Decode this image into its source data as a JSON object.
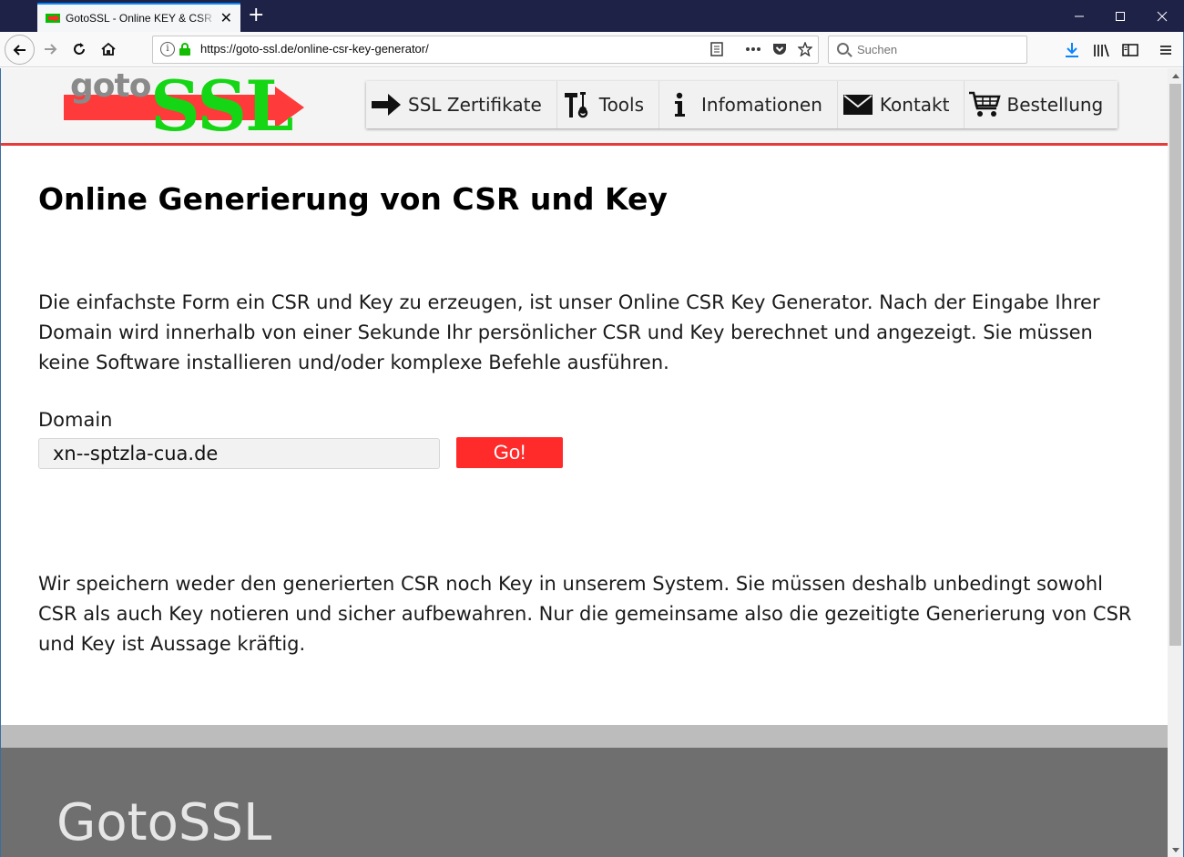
{
  "browser": {
    "tab_title": "GotoSSL - Online KEY & CSR für",
    "tab_close": "✕",
    "new_tab": "+",
    "url": "https://goto-ssl.de/online-csr-key-generator/",
    "search_placeholder": "Suchen",
    "window_controls": {
      "minimize": "—",
      "maximize": "☐",
      "close": "✕"
    }
  },
  "site": {
    "logo": {
      "goto": "goto",
      "ssl": "SSL"
    },
    "menu": [
      {
        "label": "SSL Zertifikate",
        "icon": "arrow-right-icon"
      },
      {
        "label": "Tools",
        "icon": "tools-icon"
      },
      {
        "label": "Infomationen",
        "icon": "info-icon"
      },
      {
        "label": "Kontakt",
        "icon": "mail-icon"
      },
      {
        "label": "Bestellung",
        "icon": "cart-icon"
      }
    ],
    "accent_color": "#e53b3b",
    "logo_green": "#14d614"
  },
  "main": {
    "title": "Online Generierung von CSR und Key",
    "intro": "Die einfachste Form ein CSR und Key zu erzeugen, ist unser Online CSR Key Generator. Nach der Eingabe Ihrer Domain wird innerhalb von einer Sekunde Ihr persönlicher CSR und Key berechnet und angezeigt. Sie müssen keine Software installieren und/oder komplexe Befehle ausführen.",
    "domain_label": "Domain",
    "domain_value": "xn--sptzla-cua.de",
    "go_label": "Go!",
    "notice": "Wir speichern weder den generierten CSR noch Key in unserem System. Sie müssen deshalb unbedingt sowohl CSR als auch Key notieren und sicher aufbewahren. Nur die gemeinsame also die gezeitigte Generierung von CSR und Key ist Aussage kräftig."
  },
  "footer": {
    "brand": "GotoSSL"
  }
}
